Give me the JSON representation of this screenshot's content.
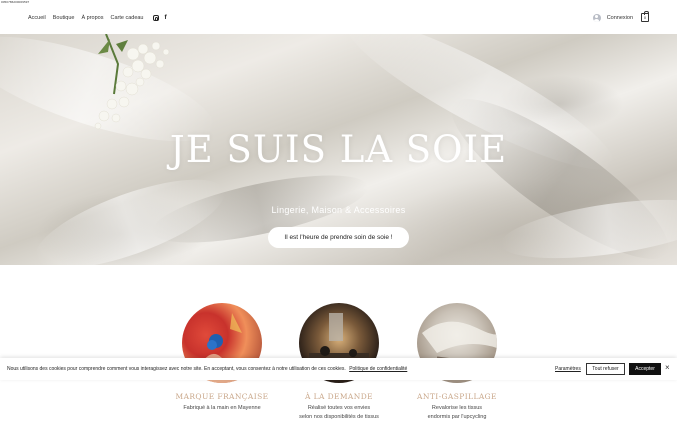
{
  "page_id": "0050786200009597",
  "nav": {
    "items": [
      "Accueil",
      "Boutique",
      "À propos",
      "Carte cadeau"
    ],
    "social": [
      {
        "icon": "instagram-icon"
      },
      {
        "icon": "facebook-icon"
      }
    ]
  },
  "account": {
    "login_label": "Connexion",
    "cart_count": "0"
  },
  "hero": {
    "title": "JE SUIS LA SOIE",
    "subtitle": "Lingerie, Maison & Accessoires",
    "cta_label": "Il est l'heure de prendre soin de soie !"
  },
  "features": [
    {
      "title": "Marque française",
      "desc_line1": "Fabriqué à la main en Mayenne",
      "desc_line2": ""
    },
    {
      "title": "À la demande",
      "desc_line1": "Réalisé toutes vos envies",
      "desc_line2": "selon nos disponibilités de tissus"
    },
    {
      "title": "Anti-gaspillage",
      "desc_line1": "Revalorise les tissus",
      "desc_line2": "endormis par l'upcycling"
    }
  ],
  "cookie": {
    "text": "Nous utilisons des cookies pour comprendre comment vous interagissez avec notre site. En acceptant, vous consentez à notre utilisation de ces cookies.",
    "policy_link": "Politique de confidentialité",
    "settings_label": "Paramètres",
    "refuse_label": "Tout refuser",
    "accept_label": "Accepter"
  },
  "colors": {
    "feature_title": "#c9a78a",
    "accept_bg": "#111111"
  }
}
